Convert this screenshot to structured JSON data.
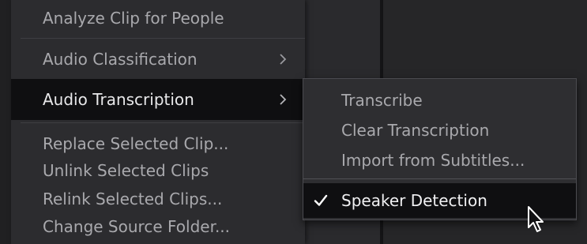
{
  "menu": {
    "items": [
      {
        "label": "Analyze Clip for People"
      },
      {
        "label": "Audio Classification",
        "submenu_icon": "chevron-right-icon"
      },
      {
        "label": "Audio Transcription",
        "submenu_icon": "chevron-right-icon",
        "highlighted": true
      },
      {
        "label": "Replace Selected Clip..."
      },
      {
        "label": "Unlink Selected Clips"
      },
      {
        "label": "Relink Selected Clips..."
      },
      {
        "label": "Change Source Folder..."
      }
    ]
  },
  "submenu": {
    "items": [
      {
        "label": "Transcribe"
      },
      {
        "label": "Clear Transcription"
      },
      {
        "label": "Import from Subtitles..."
      },
      {
        "label": "Speaker Detection",
        "checked": true,
        "highlighted": true
      }
    ]
  },
  "colors": {
    "menu_background": "#2c2c2f",
    "highlight_background": "#0f0f11",
    "text_normal": "#a9a9ad",
    "text_highlight": "#e8e8ea"
  },
  "icons": {
    "checkmark": "checkmark-icon",
    "cursor": "mouse-pointer-icon"
  }
}
